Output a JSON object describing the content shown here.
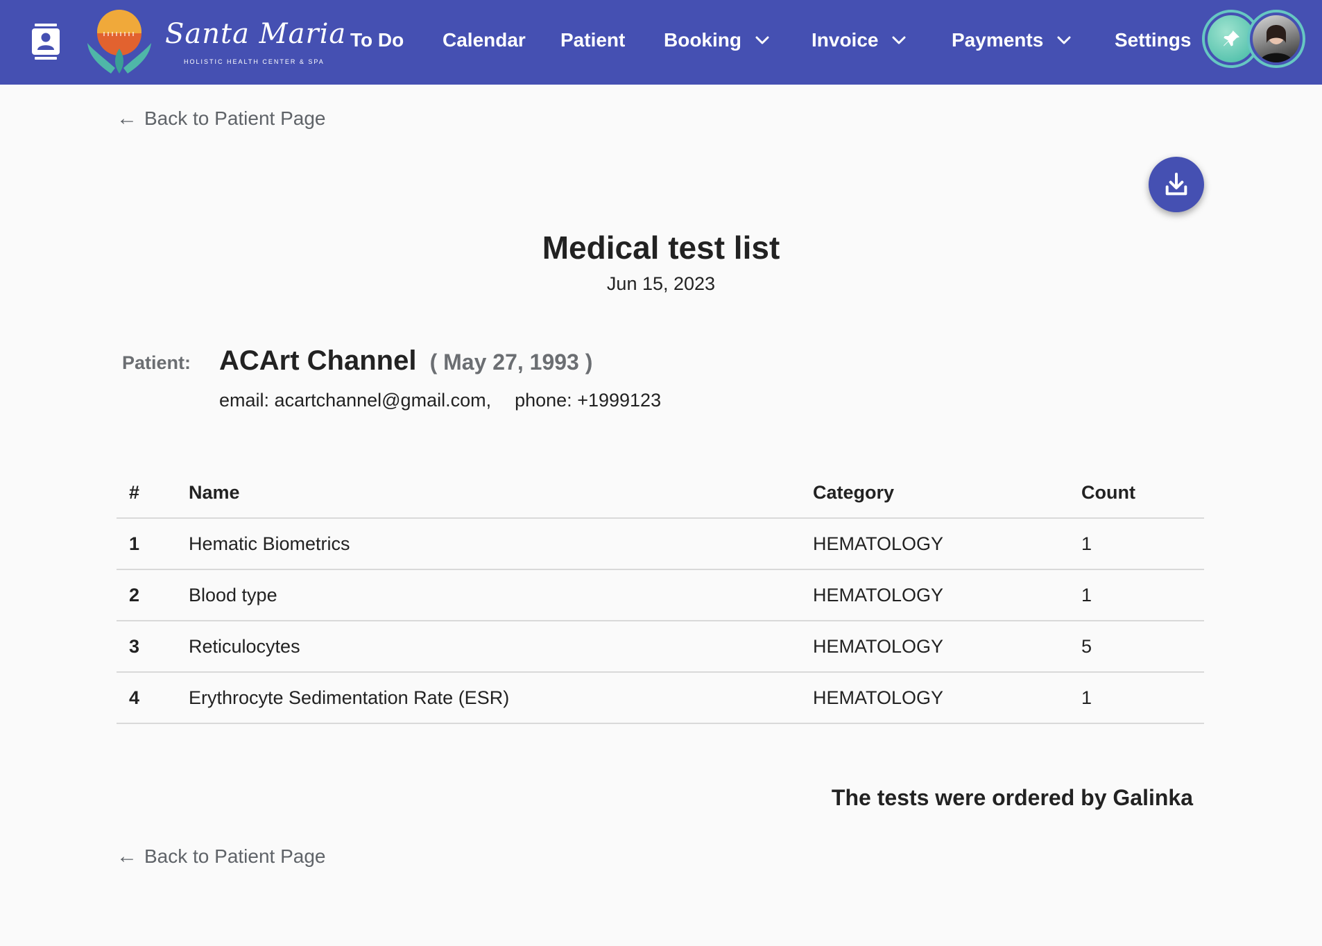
{
  "nav": {
    "brand_name": "Santa Maria",
    "brand_tagline": "HOLISTIC HEALTH CENTER & SPA",
    "items": [
      {
        "label": "To Do",
        "dropdown": false
      },
      {
        "label": "Calendar",
        "dropdown": false
      },
      {
        "label": "Patient",
        "dropdown": false
      },
      {
        "label": "Booking",
        "dropdown": true
      },
      {
        "label": "Invoice",
        "dropdown": true
      },
      {
        "label": "Payments",
        "dropdown": true
      },
      {
        "label": "Settings",
        "dropdown": false
      }
    ],
    "icons": {
      "contacts": "contacts-icon",
      "pin": "pin-icon",
      "avatar": "user-avatar"
    },
    "colors": {
      "bar": "#4550b2",
      "accent_ring": "#66c7c2"
    }
  },
  "back_link": {
    "arrow": "←",
    "label": "Back to Patient Page"
  },
  "download": {
    "icon": "download-icon"
  },
  "document": {
    "title": "Medical test list",
    "date": "Jun 15, 2023"
  },
  "patient": {
    "label": "Patient:",
    "name": "ACArt Channel",
    "dob_display": "( May 27, 1993 )",
    "email_label": "email:",
    "email": "acartchannel@gmail.com,",
    "phone_label": "phone:",
    "phone": "+1999123"
  },
  "table": {
    "headers": [
      "#",
      "Name",
      "Category",
      "Count"
    ],
    "rows": [
      {
        "num": "1",
        "name": "Hematic Biometrics",
        "category": "HEMATOLOGY",
        "count": "1"
      },
      {
        "num": "2",
        "name": "Blood type",
        "category": "HEMATOLOGY",
        "count": "1"
      },
      {
        "num": "3",
        "name": "Reticulocytes",
        "category": "HEMATOLOGY",
        "count": "5"
      },
      {
        "num": "4",
        "name": "Erythrocyte Sedimentation Rate (ESR)",
        "category": "HEMATOLOGY",
        "count": "1"
      }
    ]
  },
  "footer": {
    "ordered_by": "The tests were ordered by Galinka"
  }
}
